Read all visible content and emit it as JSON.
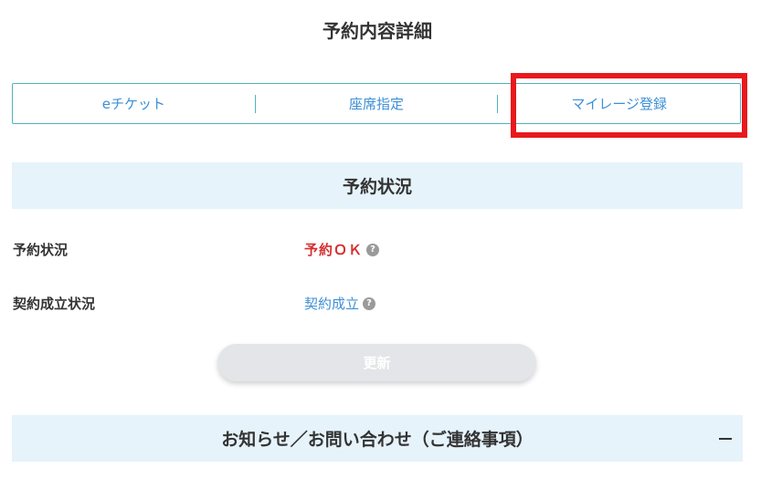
{
  "page": {
    "title": "予約内容詳細"
  },
  "tabs": [
    {
      "label": "eチケット"
    },
    {
      "label": "座席指定"
    },
    {
      "label": "マイレージ登録"
    }
  ],
  "reservation_section": {
    "title": "予約状況",
    "rows": [
      {
        "label": "予約状況",
        "value": "予約ＯＫ"
      },
      {
        "label": "契約成立状況",
        "value": "契約成立"
      }
    ]
  },
  "update_button": {
    "label": "更新"
  },
  "notice_section": {
    "title": "お知らせ／お問い合わせ（ご連絡事項）"
  },
  "colors": {
    "accent": "#4fb3bf",
    "link": "#3d8fd6",
    "ok": "#d62e2e",
    "highlight": "#e8191c",
    "section_bg": "#e6f3fb"
  },
  "icons": [
    "help-icon",
    "minus-icon"
  ]
}
